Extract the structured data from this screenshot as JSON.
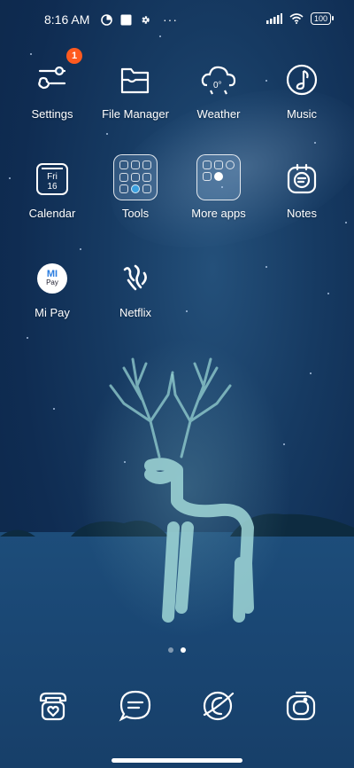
{
  "status_bar": {
    "time": "8:16 AM",
    "battery": "100",
    "icons": [
      "data-saver-icon",
      "square-notification-icon",
      "gear-icon",
      "more-dots-icon",
      "signal-icon",
      "wifi-icon",
      "battery-icon"
    ]
  },
  "apps": [
    {
      "label": "Settings",
      "icon": "settings-sliders-icon",
      "badge": "1"
    },
    {
      "label": "File Manager",
      "icon": "folder-icon"
    },
    {
      "label": "Weather",
      "icon": "weather-cloud-icon",
      "icon_text": "0°"
    },
    {
      "label": "Music",
      "icon": "music-note-icon"
    },
    {
      "label": "Calendar",
      "icon": "calendar-icon",
      "icon_day": "Fri",
      "icon_date": "16"
    },
    {
      "label": "Tools",
      "icon": "folder-grid-icon"
    },
    {
      "label": "More apps",
      "icon": "folder-grid-icon"
    },
    {
      "label": "Notes",
      "icon": "notes-icon"
    },
    {
      "label": "Mi Pay",
      "icon": "mi-pay-icon",
      "icon_mi": "MI",
      "icon_pay": "Pay"
    },
    {
      "label": "Netflix",
      "icon": "netflix-icon"
    }
  ],
  "page_indicator": {
    "count": 2,
    "active": 2
  },
  "dock": [
    {
      "name": "phone",
      "icon": "phone-heart-icon"
    },
    {
      "name": "messages",
      "icon": "message-bubble-icon"
    },
    {
      "name": "browser",
      "icon": "browser-planet-icon"
    },
    {
      "name": "camera",
      "icon": "camera-icon"
    }
  ],
  "colors": {
    "badge": "#ff5a1f",
    "background": "#163a62"
  }
}
